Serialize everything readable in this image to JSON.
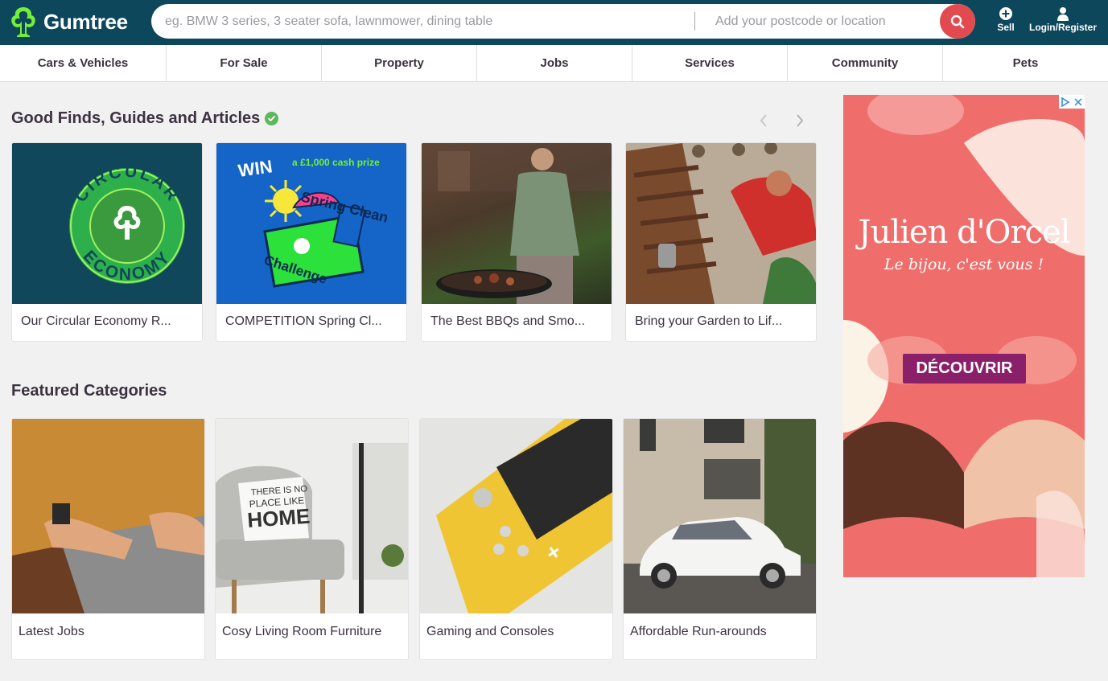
{
  "header": {
    "logo_text": "Gumtree",
    "search_placeholder": "eg. BMW 3 series, 3 seater sofa, lawnmower, dining table",
    "location_placeholder": "Add your postcode or location",
    "sell_label": "Sell",
    "login_label": "Login/Register"
  },
  "nav": {
    "items": [
      {
        "label": "Cars & Vehicles"
      },
      {
        "label": "For Sale"
      },
      {
        "label": "Property"
      },
      {
        "label": "Jobs"
      },
      {
        "label": "Services"
      },
      {
        "label": "Community"
      },
      {
        "label": "Pets"
      }
    ]
  },
  "guides": {
    "title": "Good Finds, Guides and Articles",
    "cards": [
      {
        "label": "Our Circular Economy R...",
        "image_text": [
          "CIRCULAR",
          "ECONOMY"
        ]
      },
      {
        "label": "COMPETITION Spring Cl...",
        "image_text": [
          "WIN",
          "a £1,000 cash prize",
          "Spring Clean",
          "Challenge"
        ]
      },
      {
        "label": "The Best BBQs and Smo..."
      },
      {
        "label": "Bring your Garden to Lif..."
      }
    ]
  },
  "featured": {
    "title": "Featured Categories",
    "cards": [
      {
        "label": "Latest Jobs"
      },
      {
        "label": "Cosy Living Room Furniture",
        "image_text": [
          "THERE IS NO",
          "PLACE LIKE",
          "HOME"
        ]
      },
      {
        "label": "Gaming and Consoles"
      },
      {
        "label": "Affordable Run-arounds"
      }
    ]
  },
  "ad": {
    "brand": "Julien d'Orcel",
    "tagline": "Le bijou, c'est vous !",
    "cta": "DÉCOUVRIR"
  },
  "colors": {
    "header_bg": "#0d475c",
    "brand_green": "#72ef36",
    "search_button": "#e14a4f",
    "verified_check": "#5cb85c",
    "ad_bg": "#ef6e6b",
    "ad_button": "#8a1f6a"
  }
}
